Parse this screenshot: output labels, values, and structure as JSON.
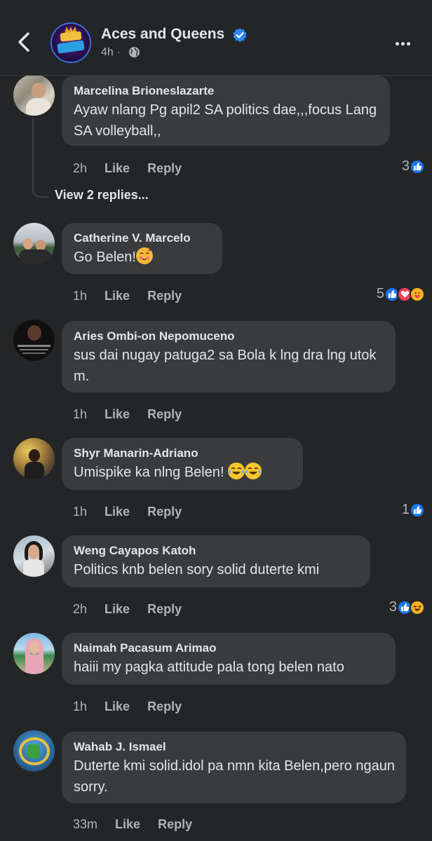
{
  "header": {
    "page_name": "Aces and Queens",
    "time": "4h",
    "dot": "·"
  },
  "thread": {
    "view_replies": "View 2 replies..."
  },
  "comments": [
    {
      "author": "Marcelina Brioneslazarte",
      "text": "Ayaw nlang Pg apil2 SA politics dae,,,focus Lang SA volleyball,,",
      "time": "2h",
      "like": "Like",
      "reply": "Reply",
      "reaction_count": "3",
      "reactions": [
        "like-icon"
      ]
    },
    {
      "author": "Catherine V. Marcelo",
      "text": "Go Belen!",
      "time": "1h",
      "like": "Like",
      "reply": "Reply",
      "reaction_count": "5",
      "reactions": [
        "like-icon",
        "love-icon",
        "care-icon"
      ],
      "emoji": [
        "smiling-hearts-emoji"
      ]
    },
    {
      "author": "Aries Ombi-on Nepomuceno",
      "text": "sus dai nugay patuga2 sa Bola k lng dra lng utok m.",
      "time": "1h",
      "like": "Like",
      "reply": "Reply"
    },
    {
      "author": "Shyr Manarin-Adriano",
      "text": "Umispike ka nlng Belen!",
      "time": "1h",
      "like": "Like",
      "reply": "Reply",
      "reaction_count": "1",
      "reactions": [
        "like-icon"
      ],
      "emoji": [
        "tears-of-joy-emoji",
        "tears-of-joy-emoji"
      ]
    },
    {
      "author": "Weng Cayapos Katoh",
      "text": "Politics knb belen sory solid duterte kmi",
      "time": "2h",
      "like": "Like",
      "reply": "Reply",
      "reaction_count": "3",
      "reactions": [
        "like-icon",
        "haha-icon"
      ]
    },
    {
      "author": "Naimah Pacasum Arimao",
      "text": "haiii my pagka attitude pala tong belen nato",
      "time": "1h",
      "like": "Like",
      "reply": "Reply"
    },
    {
      "author": "Wahab J. Ismael",
      "text": "Duterte kmi solid.idol pa nmn kita Belen,pero ngaun sorry.",
      "time": "33m",
      "like": "Like",
      "reply": "Reply"
    }
  ],
  "colors": {
    "background": "#242526",
    "bubble": "#3a3b3c",
    "like_blue": "#1877f2",
    "love_red": "#f33e58",
    "verified_blue": "#2d88ff"
  }
}
